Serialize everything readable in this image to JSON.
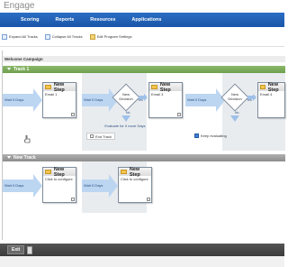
{
  "app": {
    "title": "Engage"
  },
  "nav": {
    "items": [
      "",
      "Scoring",
      "Reports",
      "Resources",
      "Applications"
    ]
  },
  "toolbar": {
    "expand_all": "Expand All Tracks",
    "collapse_all": "Collapse All Tracks",
    "edit_settings": "Edit Program Settings"
  },
  "campaign": {
    "name": "Welcome Campaign"
  },
  "track1": {
    "header": "Track 1",
    "wait1": "Wait 0 Days",
    "step1": {
      "title": "New Step",
      "subtitle": "Email 1"
    },
    "wait2": "Wait 0 Days",
    "decision1": {
      "line1": "New",
      "line2": "Decision",
      "yes": "Yes",
      "no": "No"
    },
    "step2": {
      "title": "New Step",
      "subtitle": "Email 3"
    },
    "wait3": "Wait 0 Days",
    "decision2": {
      "line1": "New",
      "line2": "Decision",
      "yes": "Yes",
      "no": "No"
    },
    "step3": {
      "title": "New Step",
      "subtitle": "Email 4"
    },
    "evaluate": "Evaluate for 0 more Days",
    "end_track": "End Track",
    "keep_evaluating": "Keep evaluating"
  },
  "track2": {
    "header": "New Track",
    "wait1": "Wait 0 Days",
    "step1": {
      "title": "New Step",
      "subtitle": "Click to configure"
    },
    "wait2": "Wait 0 Days",
    "step2": {
      "title": "New Step",
      "subtitle": "Click to configure"
    }
  },
  "bottom": {
    "exit": "Exit"
  },
  "colors": {
    "nav": "#1f5fb5",
    "track1": "#7aab5a",
    "track2": "#9a9a9a",
    "arrow": "#bcd6f2"
  }
}
